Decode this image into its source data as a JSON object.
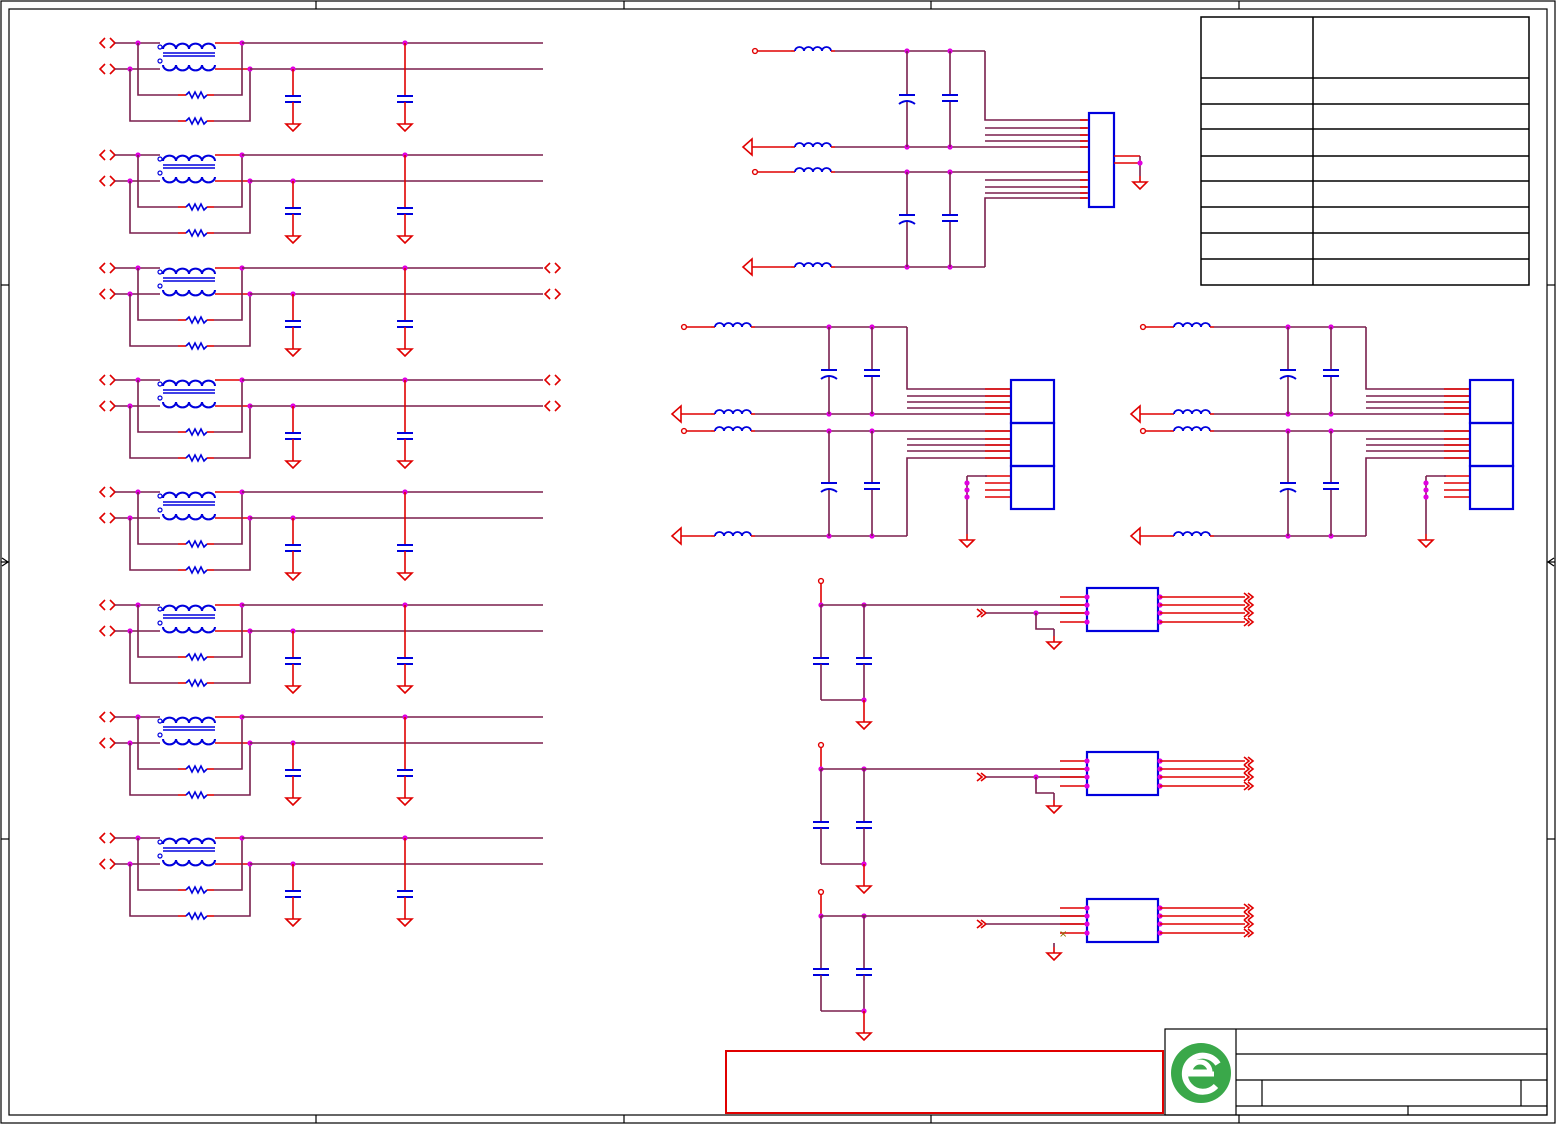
{
  "colors": {
    "wire": "#7a1f4d",
    "pin": "#e00000",
    "component": "#0000dd",
    "junction": "#e000e0",
    "frame": "#000000",
    "logo_green": "#3aa84a"
  },
  "icons": {
    "logo": "easyeda-logo-icon",
    "ground": "ground-icon",
    "net_port": "net-port-arrow-icon",
    "inductor": "inductor-icon",
    "capacitor": "capacitor-icon",
    "common_mode_choke": "common-mode-choke-icon"
  },
  "title_block": {
    "title": "",
    "company": "",
    "sheet": ""
  },
  "revision_table": {
    "rows": 8
  }
}
